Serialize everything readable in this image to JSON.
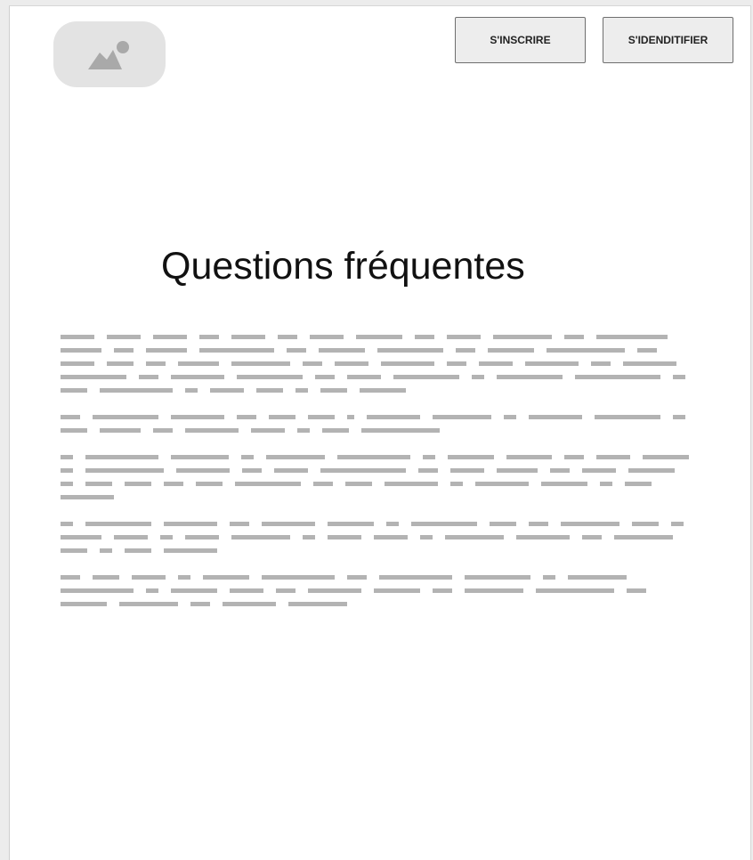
{
  "header": {
    "logo_icon": "image-placeholder-icon",
    "register_label": "S'INSCRIRE",
    "login_label": "S'IDENDITIFIER"
  },
  "main": {
    "title": "Questions fréquentes"
  },
  "colors": {
    "page_background": "#ffffff",
    "outer_background": "#ececec",
    "logo_placeholder": "#e3e3e3",
    "logo_icon": "#a9a9a9",
    "button_background": "#ededed",
    "button_border": "#6e6e6e",
    "placeholder_text": "#b3b3b3"
  }
}
